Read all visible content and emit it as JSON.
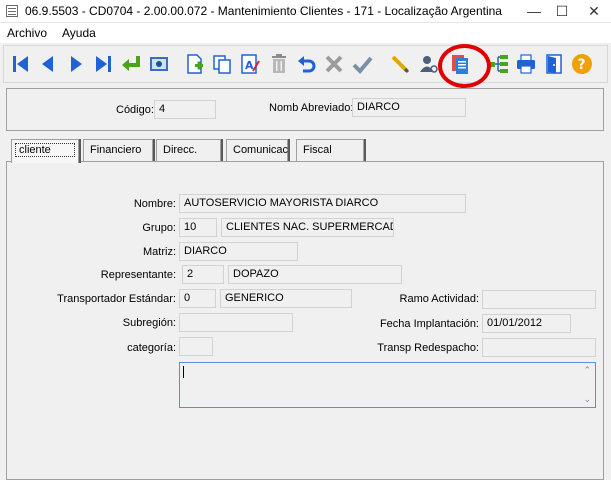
{
  "window": {
    "title": "06.9.5503 - CD0704 - 2.00.00.072 - Mantenimiento Clientes - 171 - Localização Argentina",
    "minimize_glyph": "—",
    "maximize_glyph": "☐",
    "close_glyph": "✕"
  },
  "menu": {
    "file": "Archivo",
    "help": "Ayuda"
  },
  "toolbar": {
    "icons": [
      "first-record-icon",
      "previous-record-icon",
      "next-record-icon",
      "last-record-icon",
      "goto-record-icon",
      "view-icon",
      "new-record-icon",
      "copy-record-icon",
      "modify-record-icon",
      "delete-record-icon",
      "undo-icon",
      "cancel-icon",
      "save-icon",
      "edit-icon",
      "query-icon",
      "list-icon",
      "zoom-icon",
      "print-icon",
      "exit-icon",
      "help-icon"
    ],
    "colors": {
      "blue": "#1f62d6",
      "green": "#4aa31a",
      "highlight": "#e10000"
    }
  },
  "header": {
    "code_label": "Código:",
    "code_value": "4",
    "short_name_label": "Nomb Abreviado:",
    "short_name_value": "DIARCO"
  },
  "tabs": [
    {
      "label": "cliente"
    },
    {
      "label": "Financiero"
    },
    {
      "label": "Direcc."
    },
    {
      "label": "Comunicac"
    },
    {
      "label": "Fiscal"
    }
  ],
  "form": {
    "name_label": "Nombre:",
    "name_value": "AUTOSERVICIO MAYORISTA DIARCO",
    "group_label": "Grupo:",
    "group_code": "10",
    "group_desc": "CLIENTES NAC. SUPERMERCAD(",
    "parent_label": "Matriz:",
    "parent_value": "DIARCO",
    "rep_label": "Representante:",
    "rep_code": "2",
    "rep_name": "DOPAZO",
    "carrier_label": "Transportador Estándar:",
    "carrier_code": "0",
    "carrier_name": "GENERICO",
    "activity_label": "Ramo Actividad:",
    "activity_value": "",
    "subregion_label": "Subregión:",
    "subregion_value": "",
    "impl_date_label": "Fecha Implantación:",
    "impl_date_value": "01/01/2012",
    "category_label": "categoría:",
    "category_value": "",
    "redispatch_label": "Transp Redespacho:",
    "redispatch_value": "",
    "scroll_up_glyph": "⌃",
    "scroll_down_glyph": "⌄"
  }
}
